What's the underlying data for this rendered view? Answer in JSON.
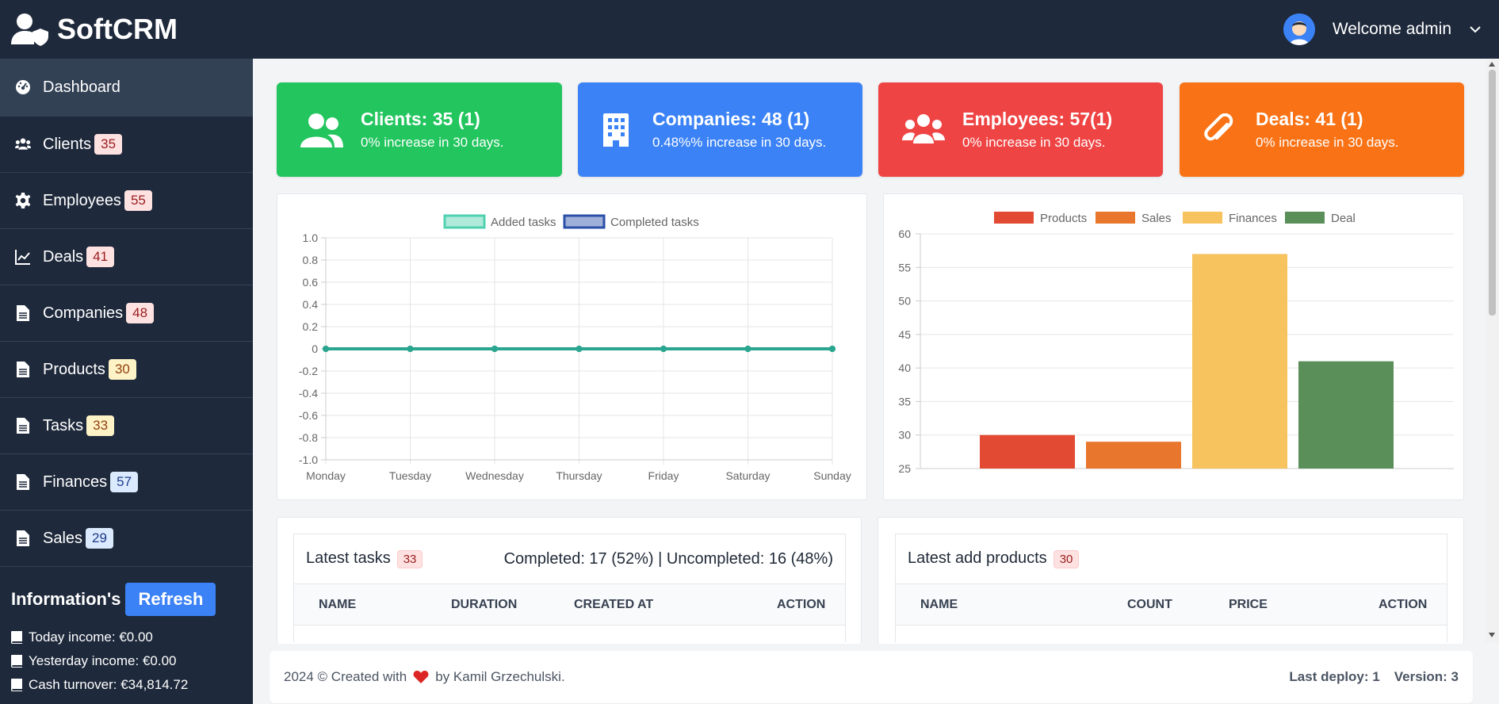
{
  "brand": {
    "name": "SoftCRM"
  },
  "user": {
    "welcome": "Welcome admin"
  },
  "sidebar": {
    "items": [
      {
        "label": "Dashboard",
        "icon": "dashboard-icon",
        "badge": ""
      },
      {
        "label": "Clients",
        "icon": "users-icon",
        "badge": "35",
        "badge_color": "red"
      },
      {
        "label": "Employees",
        "icon": "gear-icon",
        "badge": "55",
        "badge_color": "red"
      },
      {
        "label": "Deals",
        "icon": "line-chart-icon",
        "badge": "41",
        "badge_color": "red"
      },
      {
        "label": "Companies",
        "icon": "document-icon",
        "badge": "48",
        "badge_color": "red"
      },
      {
        "label": "Products",
        "icon": "document-icon",
        "badge": "30",
        "badge_color": "yellow"
      },
      {
        "label": "Tasks",
        "icon": "document-icon",
        "badge": "33",
        "badge_color": "yellow"
      },
      {
        "label": "Finances",
        "icon": "document-icon",
        "badge": "57",
        "badge_color": "blue"
      },
      {
        "label": "Sales",
        "icon": "document-icon",
        "badge": "29",
        "badge_color": "blue"
      }
    ],
    "info_title": "Information's",
    "refresh_label": "Refresh",
    "info_lines": [
      "Today income: €0.00",
      "Yesterday income: €0.00",
      "Cash turnover: €34,814.72"
    ]
  },
  "cards": [
    {
      "title": "Clients: 35 (1)",
      "subtitle": "0% increase in 30 days.",
      "color": "#22c55e",
      "icon": "users-icon"
    },
    {
      "title": "Companies: 48 (1)",
      "subtitle": "0.48%% increase in 30 days.",
      "color": "#3b82f6",
      "icon": "building-icon"
    },
    {
      "title": "Employees: 57(1)",
      "subtitle": "0% increase in 30 days.",
      "color": "#ef4444",
      "icon": "users-group-icon"
    },
    {
      "title": "Deals: 41 (1)",
      "subtitle": "0% increase in 30 days.",
      "color": "#f97316",
      "icon": "paperclip-icon"
    }
  ],
  "chart_data": [
    {
      "type": "line",
      "x": [
        "Monday",
        "Tuesday",
        "Wednesday",
        "Thursday",
        "Friday",
        "Saturday",
        "Sunday"
      ],
      "series": [
        {
          "name": "Added tasks",
          "values": [
            0,
            0,
            0,
            0,
            0,
            0,
            0
          ],
          "color": "#4fd1b0"
        },
        {
          "name": "Completed tasks",
          "values": [
            0,
            0,
            0,
            0,
            0,
            0,
            0
          ],
          "color": "#2b4fa8"
        }
      ],
      "yticks": [
        "1.0",
        "0.8",
        "0.6",
        "0.4",
        "0.2",
        "0",
        "-0.2",
        "-0.4",
        "-0.6",
        "-0.8",
        "-1.0"
      ],
      "ylim": [
        -1,
        1
      ],
      "grid": true,
      "legend": "top-center"
    },
    {
      "type": "bar",
      "categories": [
        "Products",
        "Sales",
        "Finances",
        "Deal"
      ],
      "values": [
        30,
        29,
        57,
        41
      ],
      "colors": [
        "#e34a33",
        "#e8762d",
        "#f6c35f",
        "#5a8f5a"
      ],
      "yticks": [
        "60",
        "55",
        "50",
        "45",
        "40",
        "35",
        "30",
        "25"
      ],
      "ylim": [
        25,
        60
      ],
      "grid": true,
      "legend": "top-center"
    }
  ],
  "tasks_table": {
    "title": "Latest tasks",
    "badge": "33",
    "summary": "Completed: 17 (52%) | Uncompleted: 16 (48%)",
    "columns": [
      "NAME",
      "DURATION",
      "CREATED AT",
      "ACTION"
    ]
  },
  "products_table": {
    "title": "Latest add products",
    "badge": "30",
    "columns": [
      "NAME",
      "COUNT",
      "PRICE",
      "ACTION"
    ]
  },
  "footer": {
    "left_prefix": "2024 © Created with",
    "left_suffix": "by Kamil Grzechulski.",
    "last_deploy": "Last deploy: 1",
    "version": "Version: 3"
  }
}
